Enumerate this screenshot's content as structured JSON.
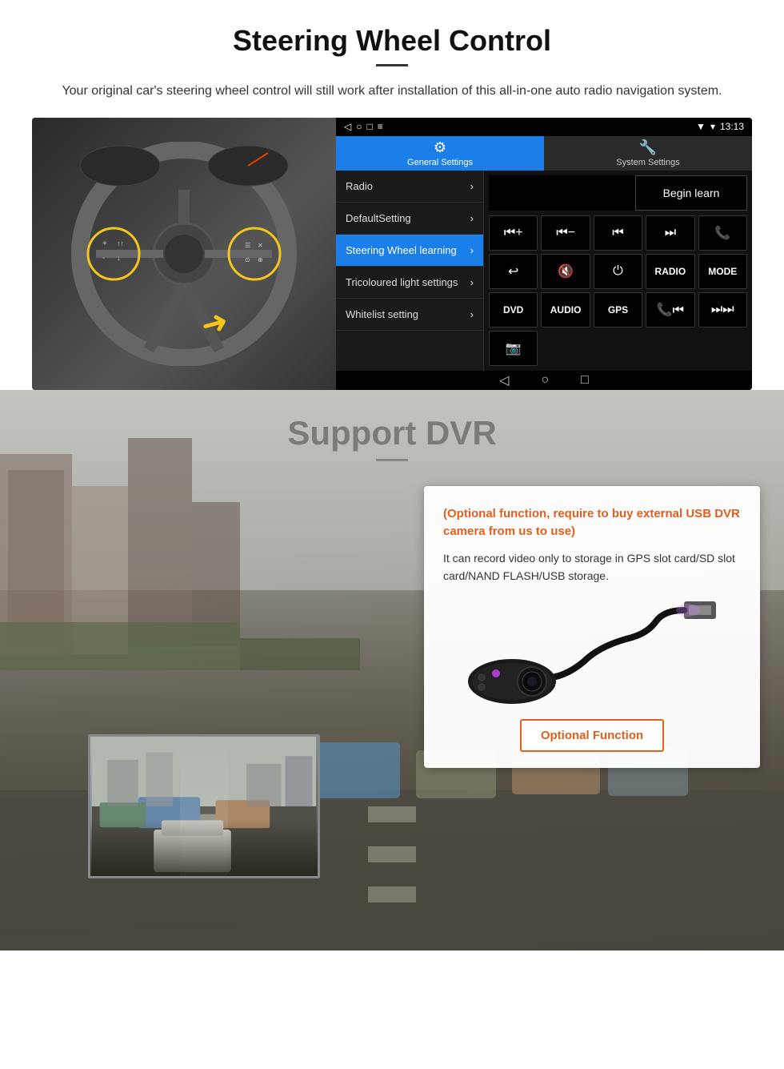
{
  "steering": {
    "title": "Steering Wheel Control",
    "description": "Your original car's steering wheel control will still work after installation of this all-in-one auto radio navigation system.",
    "android": {
      "statusbar": {
        "time": "13:13",
        "signal_icon": "▼",
        "wifi_icon": "▾"
      },
      "tabs": [
        {
          "label": "General Settings",
          "active": true
        },
        {
          "label": "System Settings",
          "active": false
        }
      ],
      "menu_items": [
        {
          "label": "Radio",
          "active": false
        },
        {
          "label": "DefaultSetting",
          "active": false
        },
        {
          "label": "Steering Wheel learning",
          "active": true
        },
        {
          "label": "Tricoloured light settings",
          "active": false
        },
        {
          "label": "Whitelist setting",
          "active": false
        }
      ],
      "begin_learn_label": "Begin learn",
      "control_buttons": [
        "⏮+",
        "⏮-",
        "⏮⏮",
        "⏭⏭",
        "📞",
        "↩",
        "🔇",
        "⏻",
        "RADIO",
        "MODE",
        "DVD",
        "AUDIO",
        "GPS",
        "📞⏮",
        "⏭⏭"
      ]
    }
  },
  "dvr": {
    "title": "Support DVR",
    "card": {
      "orange_text": "(Optional function, require to buy external USB DVR camera from us to use)",
      "body_text": "It can record video only to storage in GPS slot card/SD slot card/NAND FLASH/USB storage.",
      "optional_button_label": "Optional Function"
    }
  }
}
